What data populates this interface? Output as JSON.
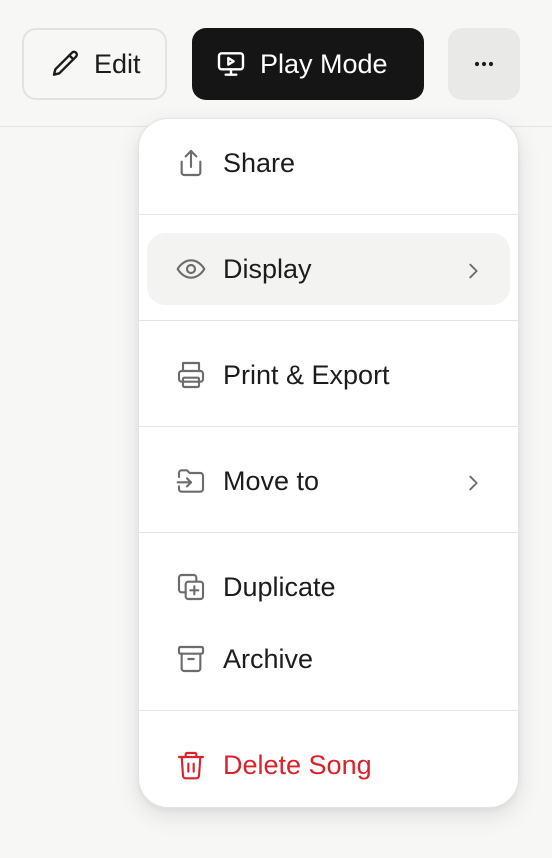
{
  "toolbar": {
    "edit_label": "Edit",
    "edit_icon": "pencil-icon",
    "play_label": "Play Mode",
    "play_icon": "monitor-play-icon",
    "more_icon": "more-horizontal-icon"
  },
  "menu": {
    "items": [
      {
        "label": "Share",
        "icon": "share-icon"
      },
      {
        "label": "Display",
        "icon": "eye-icon",
        "submenu": true,
        "active": true
      },
      {
        "label": "Print & Export",
        "icon": "printer-icon"
      },
      {
        "label": "Move to",
        "icon": "folder-move-icon",
        "submenu": true
      },
      {
        "label": "Duplicate",
        "icon": "duplicate-icon"
      },
      {
        "label": "Archive",
        "icon": "archive-icon"
      },
      {
        "label": "Delete Song",
        "icon": "trash-icon",
        "danger": true
      }
    ]
  },
  "colors": {
    "primary_button_bg": "#151515",
    "danger": "#d8232a",
    "hover_bg": "#f3f3f2"
  }
}
